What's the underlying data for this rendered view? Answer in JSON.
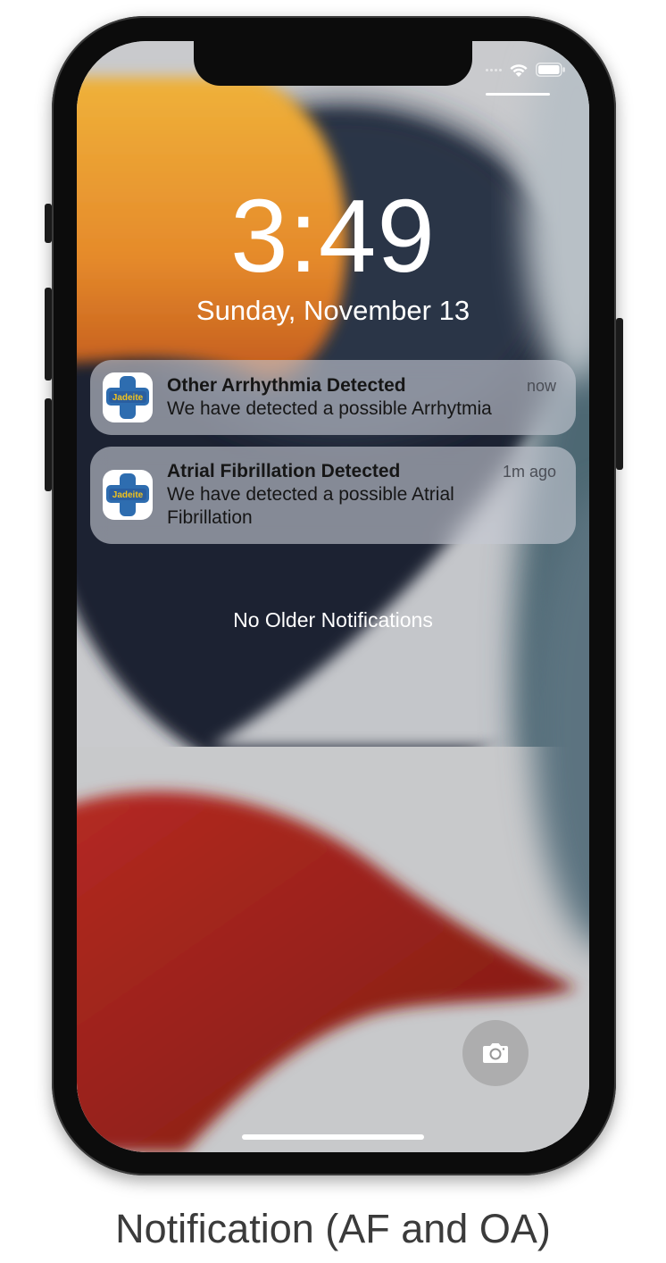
{
  "lockscreen": {
    "time": "3:49",
    "date": "Sunday, November 13",
    "no_older": "No Older Notifications"
  },
  "notifications": [
    {
      "app": "Jadeite",
      "title": "Other Arrhythmia Detected",
      "time": "now",
      "body": "We have detected a possible Arrhytmia"
    },
    {
      "app": "Jadeite",
      "title": "Atrial Fibrillation Detected",
      "time": "1m ago",
      "body": "We have detected a possible Atrial Fibrillation"
    }
  ],
  "caption": "Notification (AF and OA)",
  "icons": {
    "status": [
      "cellular-dots-icon",
      "wifi-icon",
      "battery-icon"
    ],
    "quick_action": "camera-icon"
  },
  "colors": {
    "app_icon_cross": "#2e6db0",
    "app_icon_band": "#f2c31c",
    "app_icon_text": "#f2c31c"
  }
}
